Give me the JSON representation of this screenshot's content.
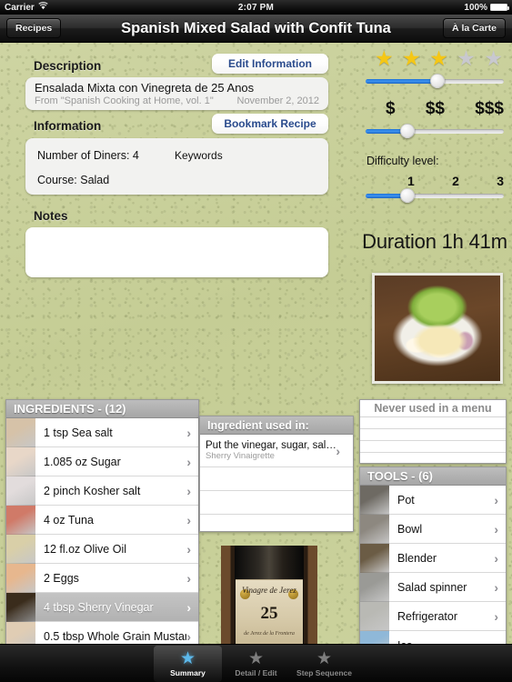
{
  "status_bar": {
    "carrier": "Carrier",
    "wifi_icon": "wifi-icon",
    "time": "2:07 PM",
    "battery_percent": "100%"
  },
  "navbar": {
    "back_label": "Recipes",
    "title": "Spanish Mixed Salad with Confit Tuna",
    "right_label": "À la Carte"
  },
  "description": {
    "heading": "Description",
    "edit_button": "Edit Information",
    "recipe_name": "Ensalada Mixta con Vinegreta de 25 Anos",
    "source": "From \"Spanish Cooking at Home, vol. 1\"",
    "date": "November 2, 2012"
  },
  "information": {
    "heading": "Information",
    "bookmark_button": "Bookmark Recipe",
    "diners": "Number of Diners: 4",
    "keywords_label": "Keywords",
    "course": "Course: Salad"
  },
  "notes": {
    "heading": "Notes",
    "value": "",
    "placeholder": ""
  },
  "rating": {
    "stars_filled": 3,
    "stars_total": 5,
    "star_on_color": "#f5c715",
    "star_off_color": "#c8c8cf",
    "slider_percent": 52
  },
  "price": {
    "levels": [
      "$",
      "$$",
      "$$$"
    ],
    "slider_percent": 30
  },
  "difficulty": {
    "label": "Difficulty level:",
    "levels": [
      "1",
      "2",
      "3"
    ],
    "slider_percent": 30
  },
  "duration": {
    "text": "Duration 1h 41m"
  },
  "photo": {
    "name": "salad-photo",
    "alt": "Spanish mixed salad plated with egg and onion"
  },
  "ingredients": {
    "header": "INGREDIENTS  -  (12)",
    "count": 12,
    "items": [
      {
        "qty": "1 tsp",
        "name": "Sea salt",
        "selected": false,
        "thumb": "#d6c2a8"
      },
      {
        "qty": "1.085 oz",
        "name": "Sugar",
        "selected": false,
        "thumb": "#e8d7c8"
      },
      {
        "qty": "2 pinch",
        "name": "Kosher salt",
        "selected": false,
        "thumb": "#e2dcdc"
      },
      {
        "qty": "4 oz",
        "name": "Tuna",
        "selected": false,
        "thumb": "#d07a68"
      },
      {
        "qty": "12 fl.oz",
        "name": "Olive Oil",
        "selected": false,
        "thumb": "#d9cfa8"
      },
      {
        "qty": "2",
        "name": "Eggs",
        "selected": false,
        "thumb": "#e7b78e"
      },
      {
        "qty": "4 tbsp",
        "name": "Sherry Vinegar",
        "selected": true,
        "thumb": "#3a2c1c"
      },
      {
        "qty": "0.5 tbsp",
        "name": "Whole Grain Mustard",
        "selected": false,
        "thumb": "#e0cdb4"
      }
    ]
  },
  "ingredient_used_in": {
    "header": "Ingredient used in:",
    "items": [
      {
        "title": "Put the vinegar, sugar, sal…",
        "subtitle": "Sherry Vinaigrette"
      }
    ],
    "blank_rows": 3
  },
  "menu_panel": {
    "header": "Never used in a menu",
    "blank_rows": 4
  },
  "tools": {
    "header": "TOOLS  -  (6)",
    "count": 6,
    "items": [
      {
        "name": "Pot",
        "thumb": "#6e6a63"
      },
      {
        "name": "Bowl",
        "thumb": "#8d8880"
      },
      {
        "name": "Blender",
        "thumb": "#6b5c45"
      },
      {
        "name": "Salad spinner",
        "thumb": "#9a9a96"
      },
      {
        "name": "Refrigerator",
        "thumb": "#b9b9b4"
      },
      {
        "name": "Ice",
        "thumb": "#8fb8d8"
      }
    ]
  },
  "bottle": {
    "label_top": "Vinagre de Jerez",
    "label_number": "25",
    "label_bottom": "de Jerez de la Frontera"
  },
  "tabbar": {
    "tabs": [
      {
        "label": "Summary",
        "icon": "star-icon",
        "active": true
      },
      {
        "label": "Detail / Edit",
        "icon": "star-icon",
        "active": false
      },
      {
        "label": "Step Sequence",
        "icon": "star-icon",
        "active": false
      }
    ]
  }
}
